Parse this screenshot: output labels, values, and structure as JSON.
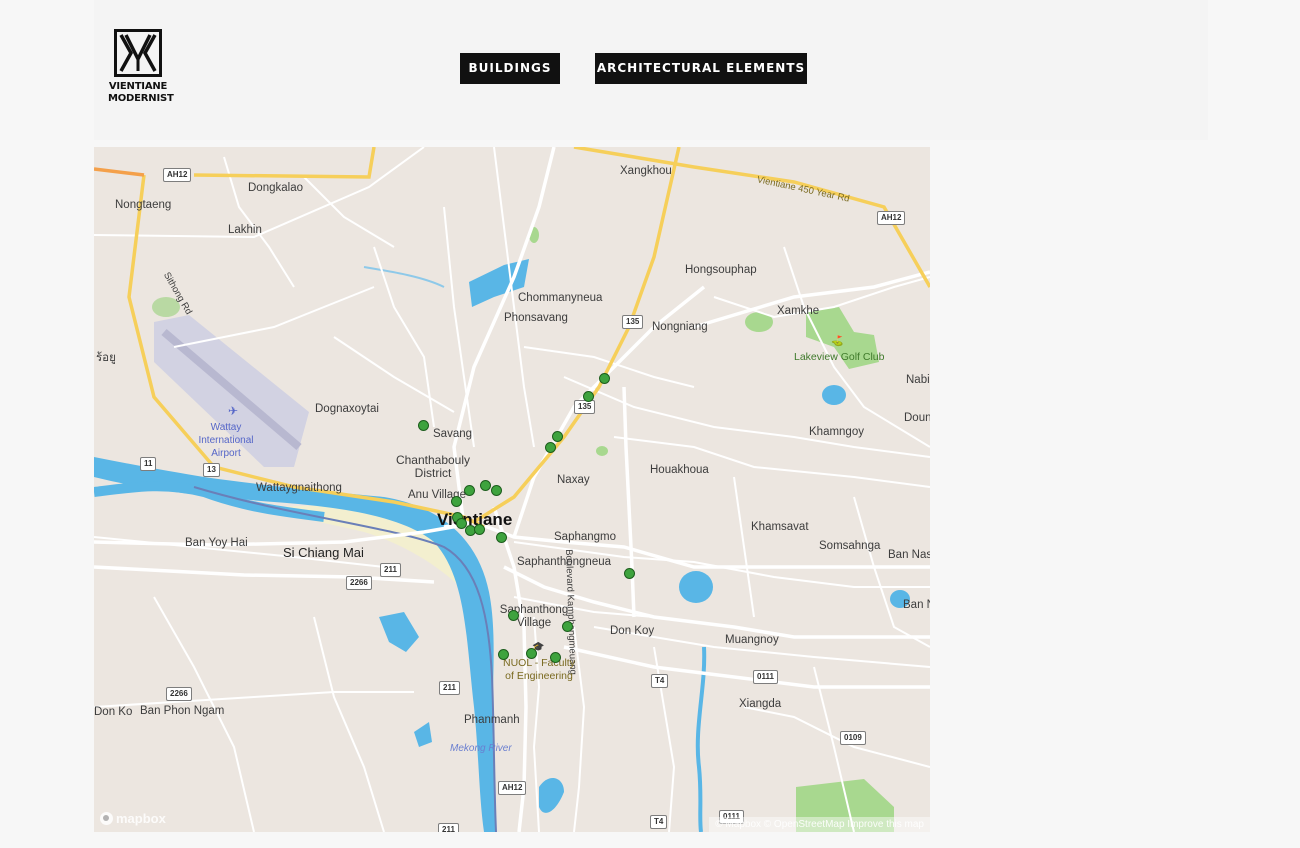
{
  "logo": {
    "line1": "VIENTIANE",
    "line2": "MODERNIST"
  },
  "nav": {
    "buildings": "BUILDINGS",
    "architectural_elements": "ARCHITECTURAL ELEMENTS"
  },
  "map": {
    "city": "Vientiane",
    "places": {
      "dongkalao": "Dongkalao",
      "nongtaeng": "Nongtaeng",
      "lakhin": "Lakhin",
      "sithong_rd": "Sithong Rd",
      "xangkhou": "Xangkhou",
      "vientiane_450": "Vientiane 450 Year Rd",
      "hongsouphap": "Hongsouphap",
      "chommanyneua": "Chommanyneua",
      "phonsavang": "Phonsavang",
      "nongniang": "Nongniang",
      "xamkhe": "Xamkhe",
      "lakeview": "Lakeview Golf Club",
      "nabi": "Nabi",
      "doun": "Doun",
      "dognaxoytai": "Dognaxoytai",
      "wattay": "Wattay International Airport",
      "savang": "Savang",
      "khamngoy": "Khamngoy",
      "chanthabouly": "Chanthabouly District",
      "houakhoua": "Houakhoua",
      "naxay": "Naxay",
      "wattaygnaithong": "Wattaygnaithong",
      "anu_village": "Anu Village",
      "boulevard": "Boulevard Kamphengmeuang",
      "khamsavat": "Khamsavat",
      "somsahnga": "Somsahnga",
      "ban_nas": "Ban Nas",
      "ban_yoy_hai": "Ban Yoy Hai",
      "si_chiang_mai": "Si Chiang Mai",
      "saphangmo": "Saphangmo",
      "saphanthongneua": "Saphanthongneua",
      "ban_n": "Ban N",
      "saphanthong_village": "Saphanthong Village",
      "don_koy": "Don Koy",
      "muangnoy": "Muangnoy",
      "nuol": "NUOL - Faculty of Engineering",
      "xiangda": "Xiangda",
      "don_ko": "Don Ko",
      "ban_phon_ngam": "Ban Phon Ngam",
      "phanmanh": "Phanmanh",
      "mekong": "Mekong River",
      "thai_town": "ร้อยู"
    },
    "shields": {
      "ah12_a": "AH12",
      "ah12_b": "AH12",
      "ah12_c": "AH12",
      "r135_a": "135",
      "r135_b": "135",
      "r11": "11",
      "r13": "13",
      "r2266_a": "2266",
      "r2266_b": "2266",
      "r211_a": "211",
      "r211_b": "211",
      "r211_c": "211",
      "t4_a": "T4",
      "t4_b": "T4",
      "r0111_a": "0111",
      "r0111_b": "0111",
      "r0109": "0109"
    },
    "mapbox": "mapbox",
    "attribution": "© Mapbox © OpenStreetMap Improve this map",
    "colors": {
      "land": "#ece6e0",
      "water": "#59b6e6",
      "park": "#a8d88f",
      "major_road": "#f6cf5a",
      "marker": "#3ea33e"
    }
  }
}
